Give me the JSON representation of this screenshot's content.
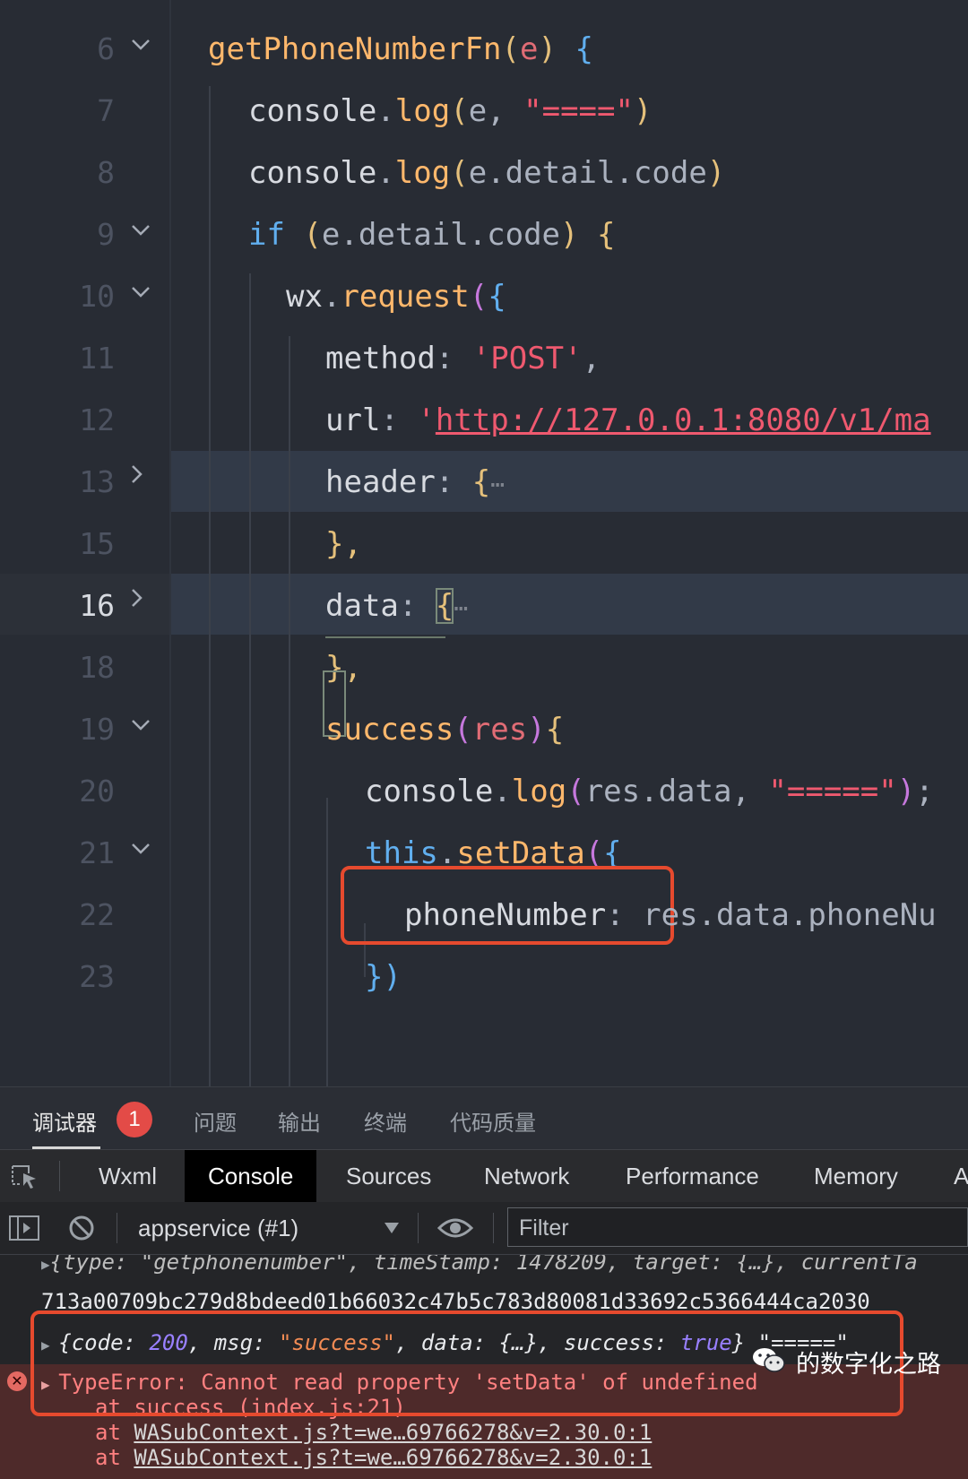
{
  "editor": {
    "lines": [
      {
        "n": "6",
        "fold": "down"
      },
      {
        "n": "7",
        "fold": ""
      },
      {
        "n": "8",
        "fold": ""
      },
      {
        "n": "9",
        "fold": "down"
      },
      {
        "n": "10",
        "fold": "down"
      },
      {
        "n": "11",
        "fold": ""
      },
      {
        "n": "12",
        "fold": ""
      },
      {
        "n": "13",
        "fold": "right"
      },
      {
        "n": "15",
        "fold": ""
      },
      {
        "n": "16",
        "fold": "right"
      },
      {
        "n": "18",
        "fold": ""
      },
      {
        "n": "19",
        "fold": "down"
      },
      {
        "n": "20",
        "fold": ""
      },
      {
        "n": "21",
        "fold": "down"
      },
      {
        "n": "22",
        "fold": ""
      },
      {
        "n": "23",
        "fold": ""
      }
    ],
    "current_line": "16",
    "code": {
      "l6_fn": "getPhoneNumberFn",
      "l6_param": "e",
      "l7_obj": "console",
      "l7_method": "log",
      "l7_arg": "e",
      "l7_str": "\"====\"",
      "l8_obj": "console",
      "l8_method": "log",
      "l8_arg": "e.detail.code",
      "l9_kw": "if",
      "l9_cond": "e.detail.code",
      "l10_obj": "wx",
      "l10_method": "request",
      "l11_key": "method",
      "l11_val": "'POST'",
      "l12_key": "url",
      "l12_val": "http://127.0.0.1:8080/v1/ma",
      "l13_key": "header",
      "l15_text": "},",
      "l16_key": "data",
      "l18_text": "},",
      "l19_fn": "success",
      "l19_param": "res",
      "l20_obj": "console",
      "l20_method": "log",
      "l20_arg": "res.data",
      "l20_str": "\"=====\"",
      "l21_kw": "this",
      "l21_method": "setData",
      "l22_key": "phoneNumber",
      "l22_val": "res.data.phoneNu",
      "l23_text": "})",
      "ellipsis": "⋯"
    }
  },
  "panel_tabs": [
    {
      "label": "调试器",
      "active": true
    },
    {
      "label": "问题"
    },
    {
      "label": "输出"
    },
    {
      "label": "终端"
    },
    {
      "label": "代码质量"
    }
  ],
  "error_badge": "1",
  "devtools_tabs": [
    "Wxml",
    "Console",
    "Sources",
    "Network",
    "Performance",
    "Memory",
    "A"
  ],
  "active_devtools_tab": "Console",
  "toolbar": {
    "context": "appservice (#1)",
    "filter_placeholder": "Filter"
  },
  "console": {
    "line1": "{type: \"getphonenumber\", timeStamp: 1478209, target: {…}, currentTa",
    "line2": "713a00709bc279d8bdeed01b66032c47b5c783d80081d33692c5366444ca2030",
    "obj_code_key": "code",
    "obj_code_val": "200",
    "obj_msg_key": "msg",
    "obj_msg_val": "\"success\"",
    "obj_data_key": "data",
    "obj_data_val": "{…}",
    "obj_success_key": "success",
    "obj_success_val": "true",
    "obj_suffix": "\"=====\"",
    "error_msg": "TypeError: Cannot read property 'setData' of undefined",
    "stack": [
      {
        "prefix": "at",
        "text": "success (index.js:21)"
      },
      {
        "prefix": "at",
        "text": "WASubContext.js?t=we…69766278&v=2.30.0:1"
      },
      {
        "prefix": "at",
        "text": "WASubContext.js?t=we…69766278&v=2.30.0:1"
      }
    ]
  },
  "watermark": "的数字化之路"
}
